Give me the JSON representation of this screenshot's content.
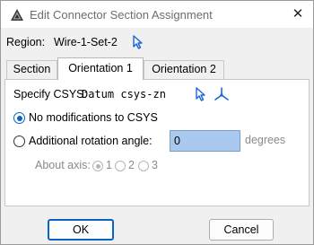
{
  "window": {
    "title": "Edit Connector Section Assignment",
    "close_glyph": "✕",
    "icons": {
      "app": "abaqus-app-icon",
      "close": "close-icon"
    }
  },
  "region": {
    "label": "Region:",
    "value": "Wire-1-Set-2",
    "pick_icon": "arrow-pick-icon"
  },
  "tabs": [
    {
      "label": "Section",
      "active": false
    },
    {
      "label": "Orientation 1",
      "active": true
    },
    {
      "label": "Orientation 2",
      "active": false
    }
  ],
  "orientation": {
    "csys_label": "Specify CSYS:",
    "csys_value": "Datum csys-zn",
    "csys_pick_icon": "arrow-pick-icon",
    "csys_create_icon": "csys-axes-icon",
    "options": [
      {
        "label": "No modifications to CSYS",
        "checked": true
      },
      {
        "label": "Additional rotation angle:",
        "checked": false
      }
    ],
    "angle_value": "0",
    "angle_unit": "degrees",
    "about_axis_label": "About axis:",
    "axes": [
      {
        "label": "1",
        "checked": true
      },
      {
        "label": "2",
        "checked": false
      },
      {
        "label": "3",
        "checked": false
      }
    ]
  },
  "buttons": {
    "ok": "OK",
    "cancel": "Cancel"
  },
  "colors": {
    "accent": "#0a64c8",
    "pick_icon": "#1a66d6",
    "input_highlight": "#a9c9ee",
    "disabled_text": "#8a8a8a"
  }
}
